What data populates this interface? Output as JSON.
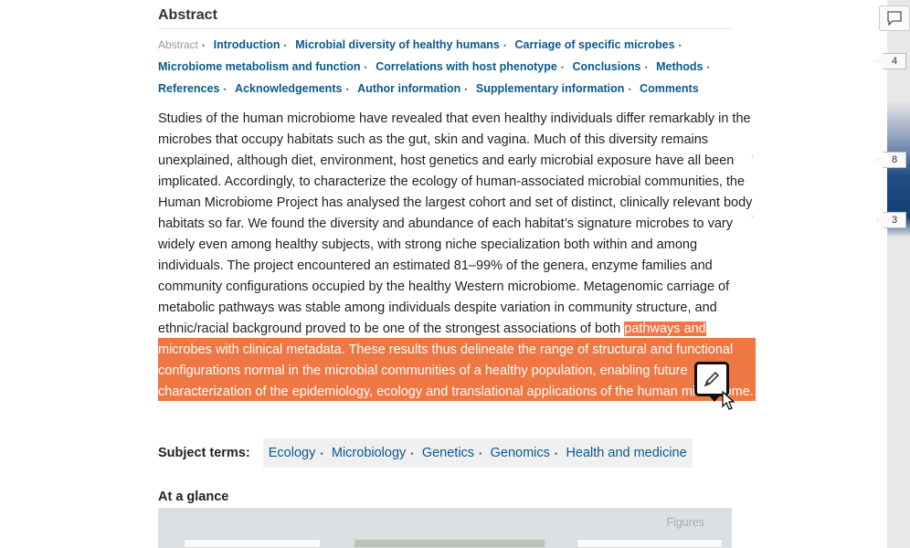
{
  "abstract_heading": "Abstract",
  "nav": {
    "current": "Abstract",
    "links": [
      "Introduction",
      "Microbial diversity of healthy humans",
      "Carriage of specific microbes",
      "Microbiome metabolism and function",
      "Correlations with host phenotype",
      "Conclusions",
      "Methods",
      "References",
      "Acknowledgements",
      "Author information",
      "Supplementary information",
      "Comments"
    ]
  },
  "abstract": {
    "text_plain": "Studies of the human microbiome have revealed that even healthy individuals differ remarkably in the microbes that occupy habitats such as the gut, skin and vagina. Much of this diversity remains unexplained, although diet, environment, host genetics and early microbial exposure have all been implicated. Accordingly, to characterize the ecology of human-associated microbial communities, the Human Microbiome Project has analysed the largest cohort and set of distinct, clinically relevant body habitats so far. We found the diversity and abundance of each habitat’s signature microbes to vary widely even among healthy subjects, with strong niche specialization both within and among individuals. The project encountered an estimated 81–99% of the genera, enzyme families and community configurations occupied by the healthy Western microbiome. Metagenomic carriage of metabolic pathways was stable among individuals despite variation in community structure, and ethnic/racial background proved to be one of the strongest associations of both",
    "text_highlighted": "pathways and microbes with clinical metadata. These results thus delineate the range of structural and functional configurations normal in the microbial communities of a healthy population, enabling future characterization of the epidemiology, ecology and translational applications of the human microbiome."
  },
  "subjects": {
    "label": "Subject terms:",
    "terms": [
      "Ecology",
      "Microbiology",
      "Genetics",
      "Genomics",
      "Health and medicine"
    ]
  },
  "glance": {
    "title": "At a glance",
    "figures_label": "Figures"
  },
  "sidebar": {
    "counts": [
      "4",
      "8",
      "3"
    ]
  },
  "colors": {
    "highlight": "#ee7744",
    "link": "#0a5a8c",
    "sidebar_accent": "#1f4e85"
  }
}
